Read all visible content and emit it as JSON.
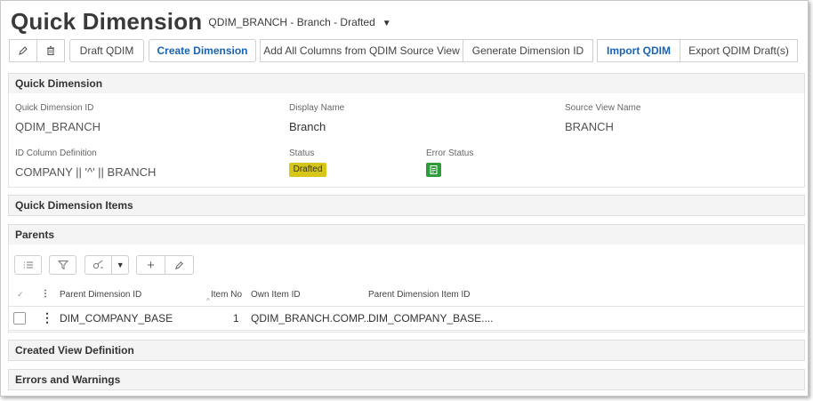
{
  "header": {
    "title": "Quick Dimension",
    "subtitle": "QDIM_BRANCH - Branch - Drafted"
  },
  "toolbar": {
    "draft_label": "Draft QDIM",
    "create_label": "Create Dimension",
    "add_all_label": "Add All Columns from QDIM Source View",
    "generate_label": "Generate Dimension ID",
    "import_label": "Import QDIM",
    "export_label": "Export QDIM Draft(s)"
  },
  "quick_dimension": {
    "section_title": "Quick Dimension",
    "id_label": "Quick Dimension ID",
    "id_value": "QDIM_BRANCH",
    "display_label": "Display Name",
    "display_value": "Branch",
    "source_label": "Source View Name",
    "source_value": "BRANCH",
    "idcol_label": "ID Column Definition",
    "idcol_value": "COMPANY || '^' || BRANCH",
    "status_label": "Status",
    "status_value": "Drafted",
    "error_label": "Error Status"
  },
  "items_section": {
    "title": "Quick Dimension Items"
  },
  "parents": {
    "title": "Parents",
    "columns": {
      "parent_dim_id": "Parent Dimension ID",
      "item_no": "Item No",
      "own_item_id": "Own Item ID",
      "parent_item_id": "Parent Dimension Item ID"
    },
    "rows": [
      {
        "parent_dim_id": "DIM_COMPANY_BASE",
        "item_no": "1",
        "own_item_id": "QDIM_BRANCH.COMP...",
        "parent_item_id": "DIM_COMPANY_BASE...."
      }
    ]
  },
  "created_view": {
    "title": "Created View Definition"
  },
  "errors": {
    "title": "Errors and Warnings"
  },
  "colors": {
    "accent_blue": "#1a63b3",
    "status_drafted": "#d6c61a",
    "status_ok": "#2f9b3d",
    "section_bg": "#f4f4f4"
  }
}
